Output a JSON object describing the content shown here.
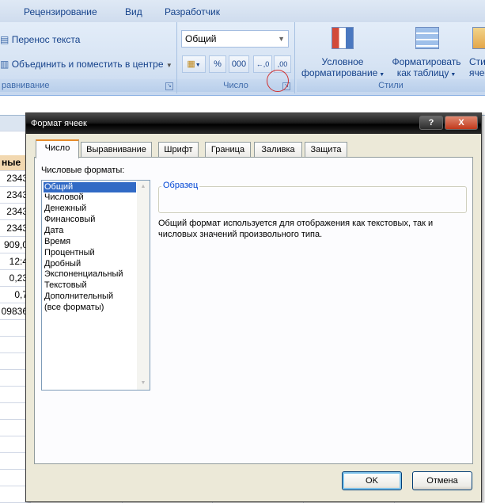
{
  "ribbon_tabs": [
    "Рецензирование",
    "Вид",
    "Разработчик"
  ],
  "alignment": {
    "wrap_text": "Перенос текста",
    "merge_center": "Объединить и поместить в центре",
    "group_label": "равнивание"
  },
  "number": {
    "format_value": "Общий",
    "percent": "%",
    "thousands": "000",
    "inc_decimal": "←,0",
    "dec_decimal": ",00",
    "group_label": "Число"
  },
  "styles": {
    "conditional": [
      "Условное",
      "форматирование"
    ],
    "as_table": [
      "Форматировать",
      "как таблицу"
    ],
    "cell_styles": [
      "Сти",
      "ячее"
    ],
    "group_label": "Стили"
  },
  "sheet": {
    "header": "ные",
    "cells": [
      "2343",
      "2343",
      "2343",
      "2343",
      "909,0",
      "12:4",
      "0,23",
      "0,7",
      "09836"
    ]
  },
  "dialog": {
    "title": "Формат ячеек",
    "help": "?",
    "close": "X",
    "tabs": [
      "Число",
      "Выравнивание",
      "Шрифт",
      "Граница",
      "Заливка",
      "Защита"
    ],
    "formats_label": "Числовые форматы:",
    "formats": [
      "Общий",
      "Числовой",
      "Денежный",
      "Финансовый",
      "Дата",
      "Время",
      "Процентный",
      "Дробный",
      "Экспоненциальный",
      "Текстовый",
      "Дополнительный",
      "(все форматы)"
    ],
    "selected_format": "Общий",
    "sample_label": "Образец",
    "description": "Общий формат используется для отображения как текстовых, так и числовых значений произвольного типа.",
    "ok": "OK",
    "cancel": "Отмена"
  }
}
